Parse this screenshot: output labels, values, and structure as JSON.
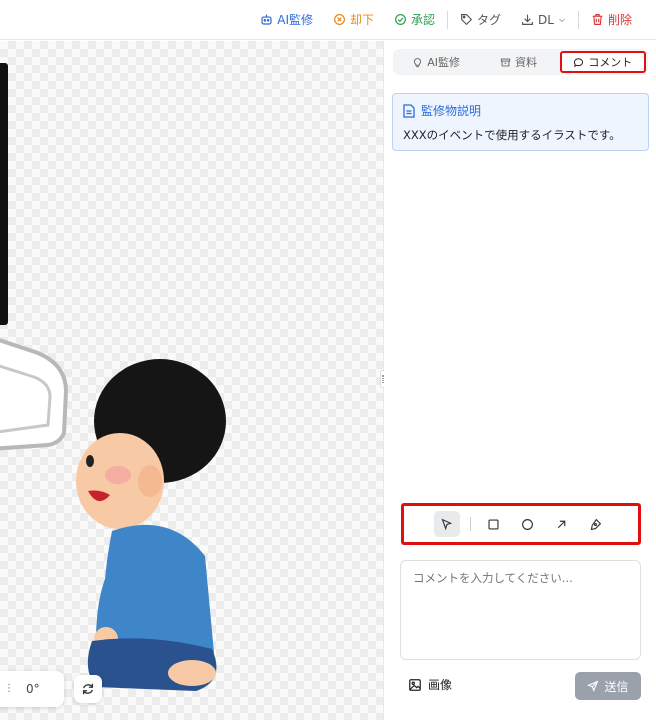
{
  "toolbar": {
    "ai_review": "AI監修",
    "reject": "却下",
    "approve": "承認",
    "tag": "タグ",
    "download": "DL",
    "delete": "削除"
  },
  "canvas": {
    "rotation": "0°"
  },
  "panel": {
    "tabs": [
      {
        "label": "AI監修"
      },
      {
        "label": "資料"
      },
      {
        "label": "コメント"
      }
    ],
    "active_tab": "コメント",
    "description": {
      "title": "監修物説明",
      "body": "XXXのイベントで使用するイラストです。"
    },
    "tools": [
      "select-arrow",
      "rectangle",
      "circle",
      "arrow",
      "pen"
    ],
    "comment_placeholder": "コメントを入力してください...",
    "image_button": "画像",
    "send_button": "送信"
  },
  "colors": {
    "primary": "#2f6bd8",
    "reject": "#e8891a",
    "approve": "#2e9e4f",
    "delete": "#d93737",
    "highlight": "#e01010"
  }
}
